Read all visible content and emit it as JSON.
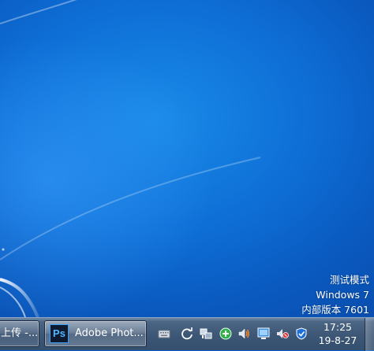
{
  "desktop": {
    "watermark": {
      "line1": "测试模式",
      "line2": "Windows 7",
      "line3": "内部版本 7601"
    }
  },
  "taskbar": {
    "buttons": [
      {
        "label": "上传 -..."
      },
      {
        "label": "Adobe Phot...",
        "icon": "Ps"
      }
    ],
    "tray_icons": [
      "keyboard-icon",
      "sync-icon",
      "network-icon",
      "green-circle-icon",
      "volume-icon",
      "monitor-icon",
      "muted-speaker-icon",
      "shield-icon"
    ],
    "clock": {
      "time": "17:25",
      "date": "19-8-27"
    }
  },
  "colors": {
    "desktop_blue": "#0e6fd6",
    "taskbar": "#3d5675"
  }
}
